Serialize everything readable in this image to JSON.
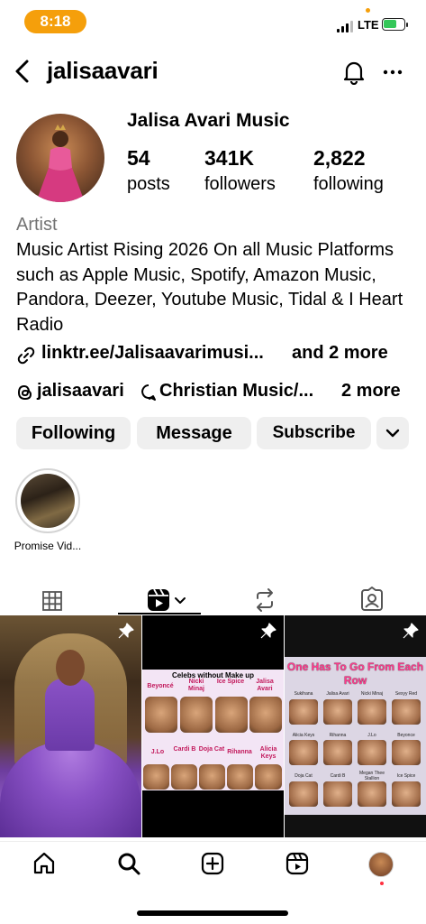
{
  "status_bar": {
    "time": "8:18",
    "network": "LTE"
  },
  "header": {
    "username": "jalisaavari"
  },
  "profile": {
    "display_name": "Jalisa Avari Music",
    "stats": [
      {
        "value": "54",
        "label": "posts"
      },
      {
        "value": "341K",
        "label": "followers"
      },
      {
        "value": "2,822",
        "label": "following"
      }
    ],
    "category": "Artist",
    "bio": "Music Artist Rising 2026 On all Music Platforms such as Apple Music, Spotify, Amazon Music, Pandora, Deezer, Youtube Music, Tidal & I Heart Radio",
    "link_text": "linktr.ee/Jalisaavarimusi...",
    "link_more": "and 2 more",
    "threads_handle": "jalisaavari",
    "channel_text": "Christian Music/...",
    "channel_more": "2 more"
  },
  "actions": {
    "following": "Following",
    "message": "Message",
    "subscribe": "Subscribe"
  },
  "highlights": [
    {
      "label": "Promise Vid..."
    }
  ],
  "posts": {
    "post2": {
      "title": "Celebs without Make up",
      "top_names": [
        "Beyoncé",
        "Nicki Minaj",
        "Ice Spice",
        "Jalisa Avari"
      ],
      "bottom_names": [
        "J.Lo",
        "Cardi B",
        "Doja Cat",
        "Rihanna",
        "Alicia Keys"
      ]
    },
    "post3": {
      "title": "One Has To Go From Each Row",
      "row1": [
        "Sukihana",
        "Jalisa Avari",
        "Nicki Minaj",
        "Sexyy Red"
      ],
      "row2": [
        "Alicia Keys",
        "Rihanna",
        "J.Lo",
        "Beyonce"
      ],
      "row3": [
        "Doja Cat",
        "Cardi B",
        "Megan Thee Stallion",
        "Ice Spice"
      ]
    }
  },
  "colors": {
    "accent_orange": "#f59f0b",
    "button_bg": "#efefef",
    "secondary_text": "#737373"
  }
}
